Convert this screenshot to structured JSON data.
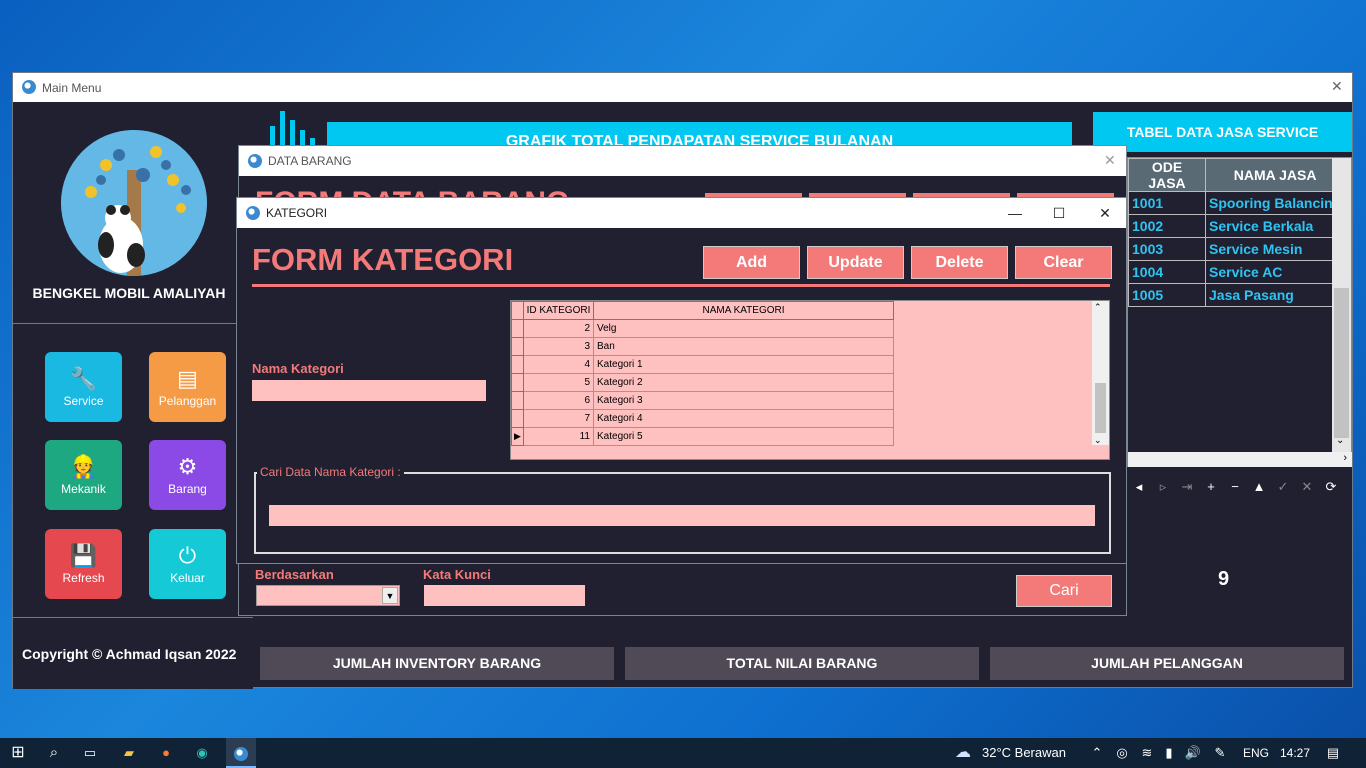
{
  "main_window": {
    "title": "Main Menu",
    "close_glyph": "✕",
    "brand": "BENGKEL MOBIL AMALIYAH",
    "copyright": "Copyright © Achmad Iqsan 2022",
    "menu": [
      {
        "label": "Service",
        "icon": "wrench-icon",
        "color": "#19b9e2"
      },
      {
        "label": "Pelanggan",
        "icon": "id-card-icon",
        "color": "#f59b45"
      },
      {
        "label": "Mekanik",
        "icon": "mechanic-icon",
        "color": "#1ea881"
      },
      {
        "label": "Barang",
        "icon": "gears-icon",
        "color": "#8b49e6"
      },
      {
        "label": "Refresh",
        "icon": "floppy-icon",
        "color": "#e5484f"
      },
      {
        "label": "Keluar",
        "icon": "power-icon",
        "color": "#15c9d6"
      }
    ],
    "chart_banner": "GRAFIK TOTAL PENDAPATAN SERVICE BULANAN",
    "jasa_table": {
      "title": "TABEL DATA JASA SERVICE",
      "columns": [
        "ODE JASA",
        "NAMA JASA"
      ],
      "rows": [
        [
          "1001",
          "Spooring Balancing"
        ],
        [
          "1002",
          "Service Berkala"
        ],
        [
          "1003",
          "Service Mesin"
        ],
        [
          "1004",
          "Service AC"
        ],
        [
          "1005",
          "Jasa Pasang"
        ]
      ]
    },
    "stat_value": "9",
    "stats": [
      "JUMLAH INVENTORY BARANG",
      "TOTAL NILAI BARANG",
      "JUMLAH PELANGGAN"
    ]
  },
  "barang_window": {
    "title": "DATA BARANG",
    "close_glyph": "✕",
    "heading_partial": "FORM DATA BARANG",
    "berdasarkan_label": "Berdasarkan",
    "kata_kunci_label": "Kata Kunci",
    "cari_button": "Cari"
  },
  "kategori_window": {
    "title": "KATEGORI",
    "form_title": "FORM KATEGORI",
    "buttons": [
      "Add",
      "Update",
      "Delete",
      "Clear"
    ],
    "nama_label": "Nama Kategori",
    "cari_group_label": "Cari Data Nama Kategori :",
    "grid": {
      "columns": [
        "ID KATEGORI",
        "NAMA KATEGORI"
      ],
      "rows": [
        [
          "2",
          "Velg"
        ],
        [
          "3",
          "Ban"
        ],
        [
          "4",
          "Kategori 1"
        ],
        [
          "5",
          "Kategori 2"
        ],
        [
          "6",
          "Kategori 3"
        ],
        [
          "7",
          "Kategori 4"
        ],
        [
          "11",
          "Kategori 5"
        ]
      ]
    }
  },
  "taskbar": {
    "weather": "32°C Berawan",
    "language": "ENG",
    "time": "14:27"
  },
  "colors": {
    "accent_cyan": "#00c8f0",
    "accent_pink": "#f47a7a",
    "field_pink": "#ffc0c0",
    "panel_dark": "#202030"
  }
}
